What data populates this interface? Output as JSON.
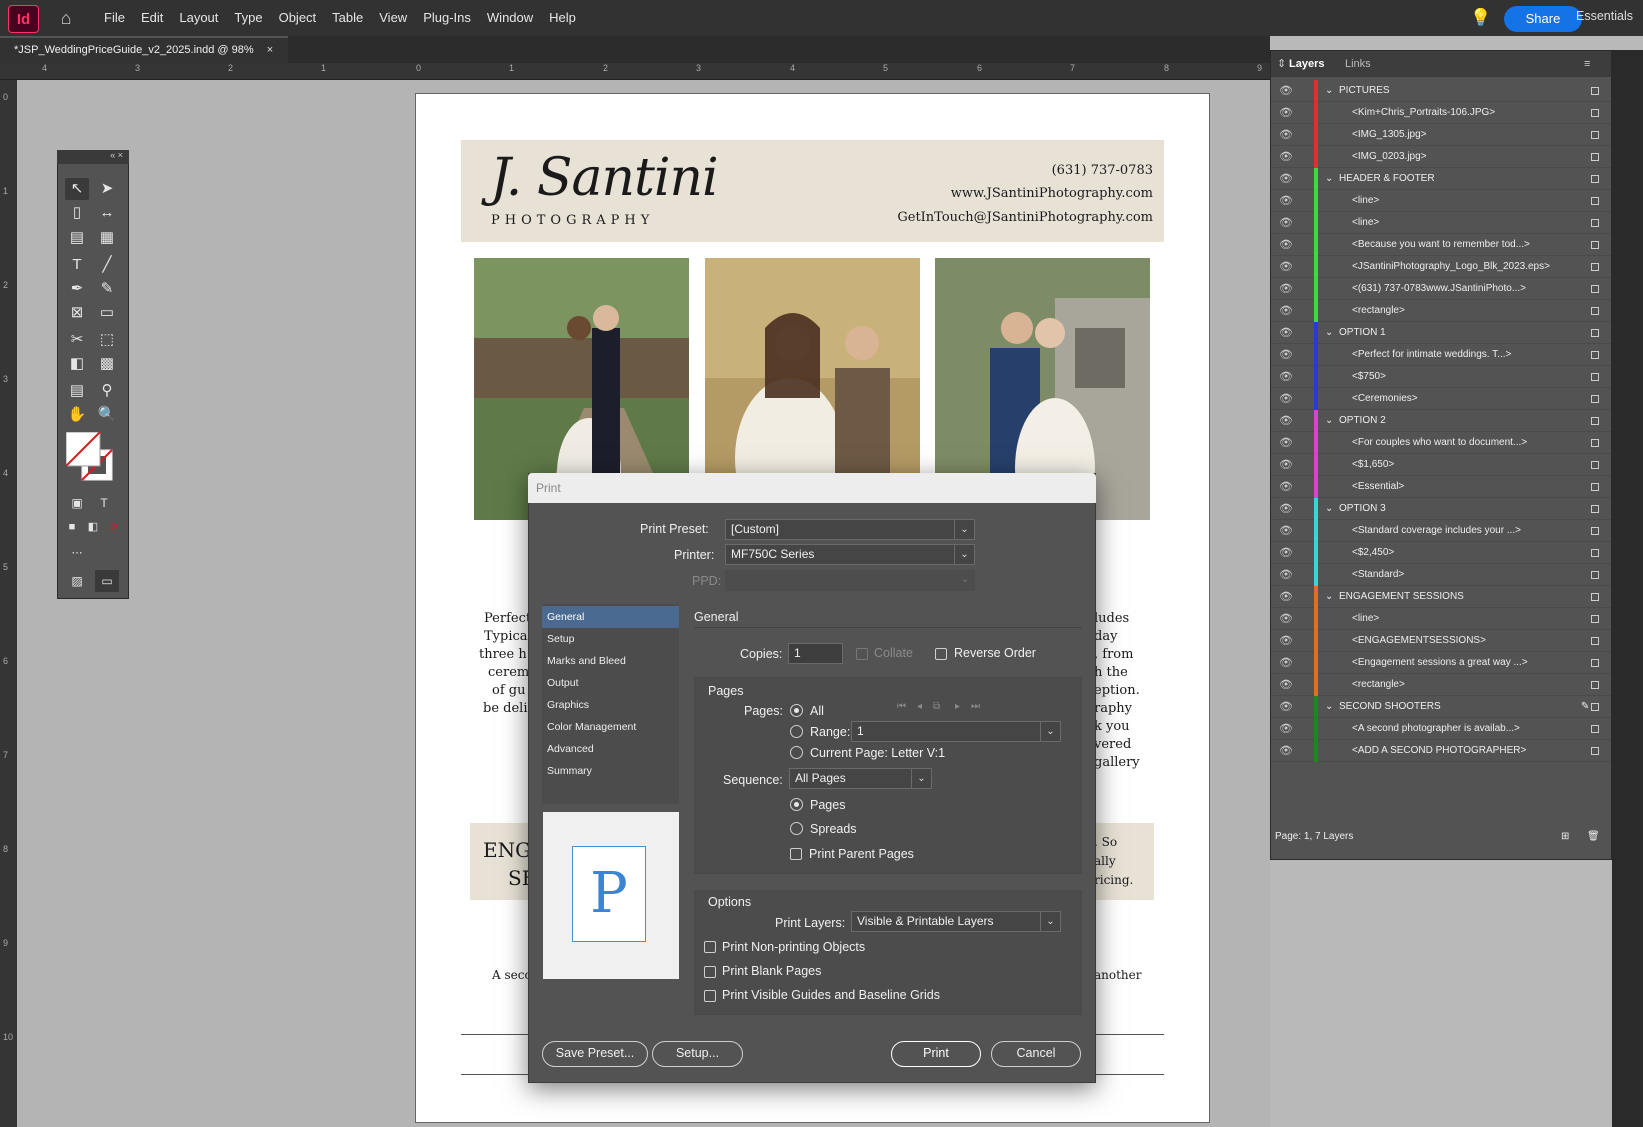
{
  "app": {
    "logo": "Id",
    "share_label": "Share",
    "workspace": "Essentials"
  },
  "menu": [
    "File",
    "Edit",
    "Layout",
    "Type",
    "Object",
    "Table",
    "View",
    "Plug-Ins",
    "Window",
    "Help"
  ],
  "document_tab": {
    "title": "*JSP_WeddingPriceGuide_v2_2025.indd @ 98%",
    "close": "×"
  },
  "ruler": {
    "h": [
      "4",
      "3",
      "2",
      "1",
      "0",
      "1",
      "2",
      "3",
      "4",
      "5",
      "6",
      "7",
      "8",
      "9"
    ],
    "v": [
      "0",
      "1",
      "2",
      "3",
      "4",
      "5",
      "6",
      "7",
      "8",
      "9",
      "10"
    ]
  },
  "page": {
    "logo_text": "J. Santini",
    "logo_sub": "PHOTOGRAPHY",
    "phone": "(631) 737-0783",
    "website": "www.JSantiniPhotography.com",
    "email": "GetInTouch@JSantiniPhotography.com",
    "left_col": [
      "Perfect",
      "Typical",
      "three h",
      "cerem",
      "of gu",
      "be deli"
    ],
    "right_col": [
      "ludes",
      "day",
      ", from",
      "h the",
      "eption.",
      "raphy",
      "k you",
      "vered",
      "gallery"
    ],
    "eng_left": [
      "ENG",
      "SE"
    ],
    "eng_right": [
      ". So",
      "ally",
      "ricing."
    ],
    "second_left": "A seco",
    "second_right": "another"
  },
  "layers_panel": {
    "tabs": [
      "Layers",
      "Links"
    ],
    "rows": [
      {
        "name": "PICTURES",
        "group": true,
        "color": "#e03030"
      },
      {
        "name": "<Kim+Chris_Portraits-106.JPG>",
        "group": false,
        "color": "#e03030"
      },
      {
        "name": "<IMG_1305.jpg>",
        "group": false,
        "color": "#e03030"
      },
      {
        "name": "<IMG_0203.jpg>",
        "group": false,
        "color": "#e03030"
      },
      {
        "name": "HEADER & FOOTER",
        "group": true,
        "color": "#3adb3a"
      },
      {
        "name": "<line>",
        "group": false,
        "color": "#3adb3a"
      },
      {
        "name": "<line>",
        "group": false,
        "color": "#3adb3a"
      },
      {
        "name": "<Because you want to remember tod...>",
        "group": false,
        "color": "#3adb3a"
      },
      {
        "name": "<JSantiniPhotography_Logo_Blk_2023.eps>",
        "group": false,
        "color": "#3adb3a"
      },
      {
        "name": "<(631) 737-0783www.JSantiniPhoto...>",
        "group": false,
        "color": "#3adb3a"
      },
      {
        "name": "<rectangle>",
        "group": false,
        "color": "#3adb3a"
      },
      {
        "name": "OPTION 1",
        "group": true,
        "color": "#2b3ad6"
      },
      {
        "name": "<Perfect for intimate weddings. T...>",
        "group": false,
        "color": "#2b3ad6"
      },
      {
        "name": "<$750>",
        "group": false,
        "color": "#2b3ad6"
      },
      {
        "name": "<Ceremonies>",
        "group": false,
        "color": "#2b3ad6"
      },
      {
        "name": "OPTION 2",
        "group": true,
        "color": "#e040d0"
      },
      {
        "name": "<For couples who want to document...>",
        "group": false,
        "color": "#e040d0"
      },
      {
        "name": "<$1,650>",
        "group": false,
        "color": "#e040d0"
      },
      {
        "name": "<Essential>",
        "group": false,
        "color": "#e040d0"
      },
      {
        "name": "OPTION  3",
        "group": true,
        "color": "#3ad6d6"
      },
      {
        "name": "<Standard coverage includes your ...>",
        "group": false,
        "color": "#3ad6d6"
      },
      {
        "name": "<$2,450>",
        "group": false,
        "color": "#3ad6d6"
      },
      {
        "name": "<Standard>",
        "group": false,
        "color": "#3ad6d6"
      },
      {
        "name": "ENGAGEMENT SESSIONS",
        "group": true,
        "color": "#e07020"
      },
      {
        "name": "<line>",
        "group": false,
        "color": "#e07020"
      },
      {
        "name": "<ENGAGEMENTSESSIONS>",
        "group": false,
        "color": "#e07020"
      },
      {
        "name": "<Engagement sessions a great way ...>",
        "group": false,
        "color": "#e07020"
      },
      {
        "name": "<rectangle>",
        "group": false,
        "color": "#e07020"
      },
      {
        "name": "SECOND SHOOTERS",
        "group": true,
        "color": "#1a8a1a"
      },
      {
        "name": "<A second photographer is availab...>",
        "group": false,
        "color": "#1a8a1a"
      },
      {
        "name": "<ADD A SECOND PHOTOGRAPHER>",
        "group": false,
        "color": "#1a8a1a"
      }
    ],
    "footer": "Page: 1, 7 Layers"
  },
  "print_dialog": {
    "title": "Print",
    "preset_label": "Print Preset:",
    "preset_value": "[Custom]",
    "printer_label": "Printer:",
    "printer_value": "MF750C Series",
    "ppd_label": "PPD:",
    "categories": [
      "General",
      "Setup",
      "Marks and Bleed",
      "Output",
      "Graphics",
      "Color Management",
      "Advanced",
      "Summary"
    ],
    "selected_category": "General",
    "section_title": "General",
    "copies_label": "Copies:",
    "copies_value": "1",
    "collate_label": "Collate",
    "reverse_label": "Reverse Order",
    "pages_group": "Pages",
    "pages_label": "Pages:",
    "all_label": "All",
    "range_label": "Range:",
    "range_value": "1",
    "current_page_label": "Current Page: Letter V:1",
    "sequence_label": "Sequence:",
    "sequence_value": "All Pages",
    "pages_radio": "Pages",
    "spreads_radio": "Spreads",
    "print_parent_label": "Print Parent Pages",
    "options_group": "Options",
    "print_layers_label": "Print Layers:",
    "print_layers_value": "Visible & Printable Layers",
    "non_printing_label": "Print Non-printing Objects",
    "blank_pages_label": "Print Blank Pages",
    "guides_label": "Print Visible Guides and Baseline Grids",
    "preview_letter": "P",
    "save_preset_btn": "Save Preset...",
    "setup_btn": "Setup...",
    "print_btn": "Print",
    "cancel_btn": "Cancel"
  }
}
